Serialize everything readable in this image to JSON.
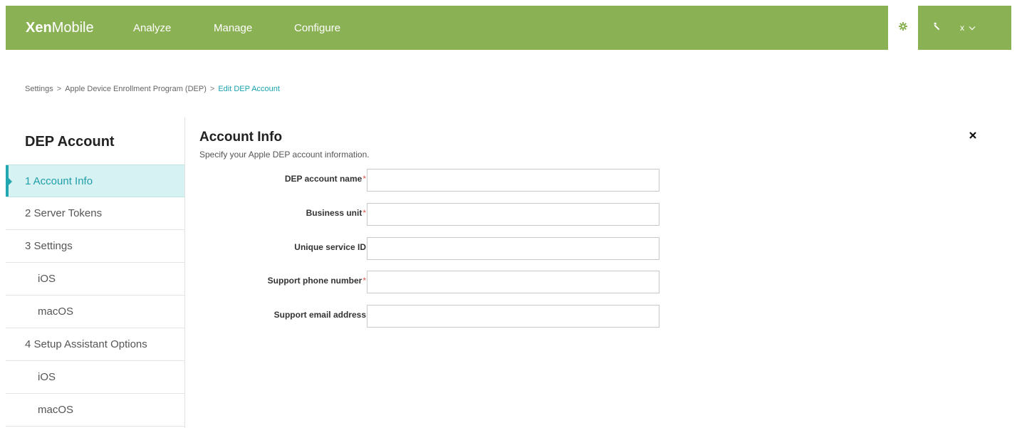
{
  "header": {
    "brand_bold": "Xen",
    "brand_light": "Mobile",
    "nav": [
      "Analyze",
      "Manage",
      "Configure"
    ],
    "settings_icon": "gear-icon",
    "support_icon": "wrench-icon",
    "user_name": "x",
    "user_menu_icon": "chevron-down-icon",
    "accent_color": "#8bb155"
  },
  "breadcrumb": {
    "items": [
      "Settings",
      "Apple Device Enrollment Program (DEP)"
    ],
    "separator": ">",
    "current": "Edit DEP Account",
    "current_color": "#1aa2ad"
  },
  "sidebar": {
    "title": "DEP Account",
    "items": [
      {
        "label": "1 Account Info",
        "active": true
      },
      {
        "label": "2 Server Tokens",
        "active": false
      },
      {
        "label": "3 Settings",
        "active": false
      },
      {
        "label": "iOS",
        "sub": true
      },
      {
        "label": "macOS",
        "sub": true
      },
      {
        "label": "4 Setup Assistant Options",
        "active": false
      },
      {
        "label": "iOS",
        "sub": true
      },
      {
        "label": "macOS",
        "sub": true
      }
    ]
  },
  "main": {
    "title": "Account Info",
    "subtitle": "Specify your Apple DEP account information.",
    "close_icon": "close-icon",
    "required_marker": "*",
    "fields": [
      {
        "label": "DEP account name",
        "required": true,
        "value": ""
      },
      {
        "label": "Business unit",
        "required": true,
        "value": ""
      },
      {
        "label": "Unique service ID",
        "required": false,
        "value": ""
      },
      {
        "label": "Support phone number",
        "required": true,
        "value": ""
      },
      {
        "label": "Support email address",
        "required": false,
        "value": ""
      }
    ]
  }
}
